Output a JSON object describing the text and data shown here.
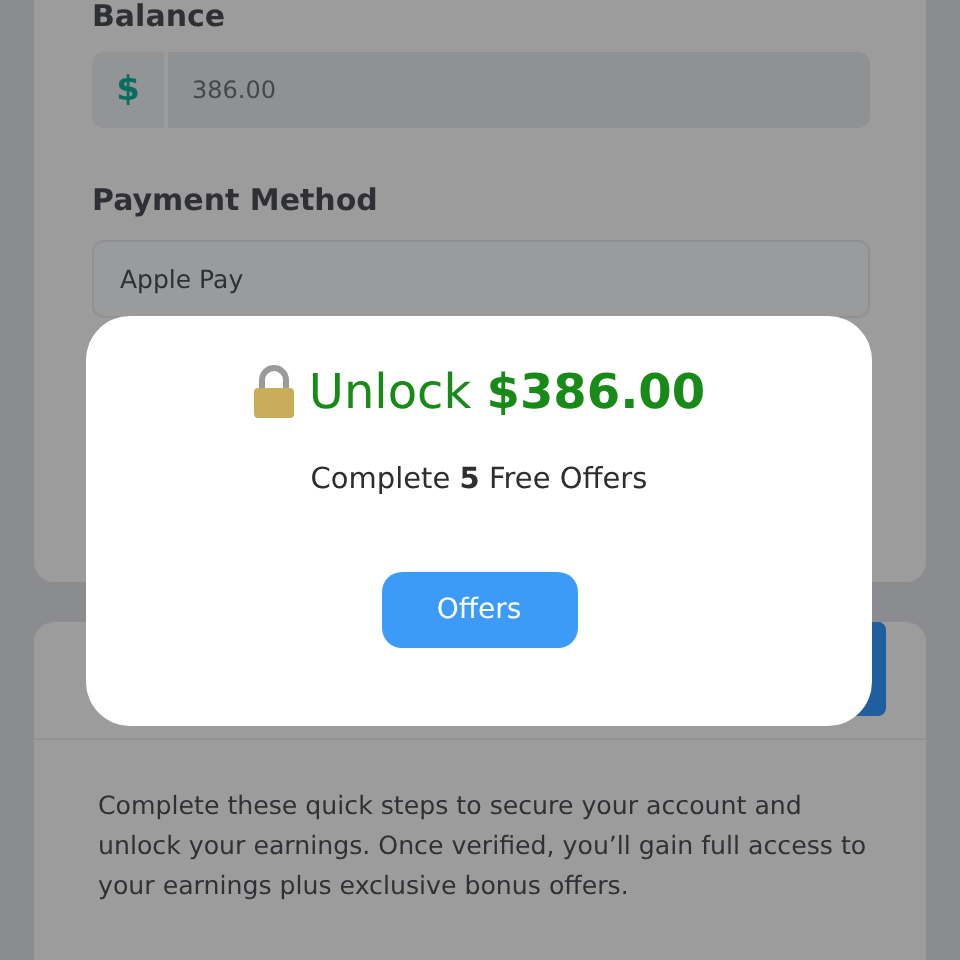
{
  "balance": {
    "label": "Balance",
    "currency": "$",
    "value": "386.00"
  },
  "payment": {
    "label": "Payment Method",
    "value": "Apple Pay"
  },
  "verify": {
    "description": "Complete these quick steps to secure your account and unlock your earnings. Once verified, you’ll gain full access to your earnings plus exclusive bonus offers."
  },
  "modal": {
    "title": "Unlock **$386.00**",
    "subtitle": "Complete **5** Free Offers",
    "button": "Offers"
  }
}
